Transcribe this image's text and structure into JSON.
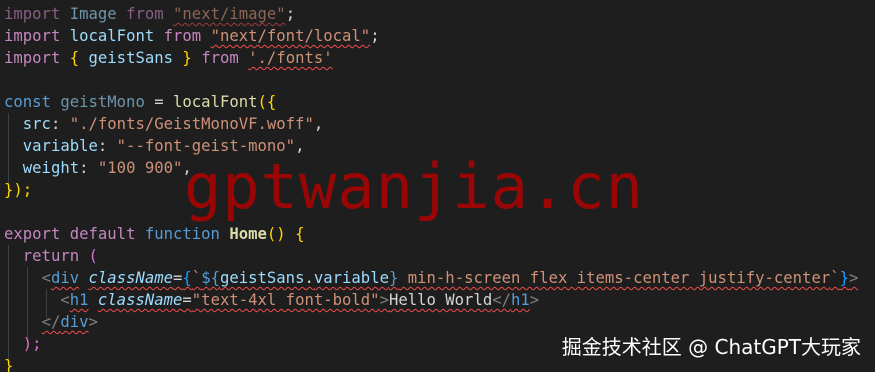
{
  "watermark": "gptwanjia.cn",
  "credit": "掘金技术社区 @ ChatGPT大玩家",
  "code": {
    "l1": {
      "kw": "import",
      "name": "Image",
      "from": "from",
      "src": "\"next/image\"",
      "semi": ";"
    },
    "l2": {
      "kw": "import",
      "name": "localFont",
      "from": "from",
      "src": "\"next/font/local\"",
      "semi": ";"
    },
    "l3": {
      "kw": "import",
      "open": "{",
      "name": "geistSans",
      "close": "}",
      "from": "from",
      "src": "'./fonts'"
    },
    "l5": {
      "kw": "const",
      "name": "geistMono",
      "eq": "=",
      "fn": "localFont",
      "open": "({"
    },
    "l6": {
      "key": "src",
      "colon": ":",
      "val": "\"./fonts/GeistMonoVF.woff\"",
      "comma": ","
    },
    "l7": {
      "key": "variable",
      "colon": ":",
      "val": "\"--font-geist-mono\"",
      "comma": ","
    },
    "l8": {
      "key": "weight",
      "colon": ":",
      "val": "\"100 900\"",
      "comma": ","
    },
    "l9": {
      "close": "});"
    },
    "l11": {
      "kw1": "export",
      "kw2": "default",
      "kw3": "function",
      "name": "Home",
      "parens": "()",
      "brace": "{"
    },
    "l12": {
      "kw": "return",
      "paren": "("
    },
    "l13": {
      "lt": "<",
      "tag": "div",
      "attr": "className",
      "eq": "=",
      "bo": "{",
      "bt": "`",
      "interp_open": "${",
      "obj": "geistSans",
      "dot": ".",
      "prop": "variable",
      "interp_close": "}",
      "text": " min-h-screen flex items-center justify-center",
      "et": "`",
      "bc": "}",
      "gt": ">"
    },
    "l14": {
      "lt": "<",
      "tag": "h1",
      "attr": "className",
      "eq": "=",
      "val": "\"text-4xl font-bold\"",
      "gt": ">",
      "text": "Hello World",
      "clt": "</",
      "ctag": "h1",
      "cgt": ">"
    },
    "l15": {
      "clt": "</",
      "tag": "div",
      "gt": ">"
    },
    "l16": {
      "close": ");"
    },
    "l17": {
      "close": "}"
    }
  }
}
